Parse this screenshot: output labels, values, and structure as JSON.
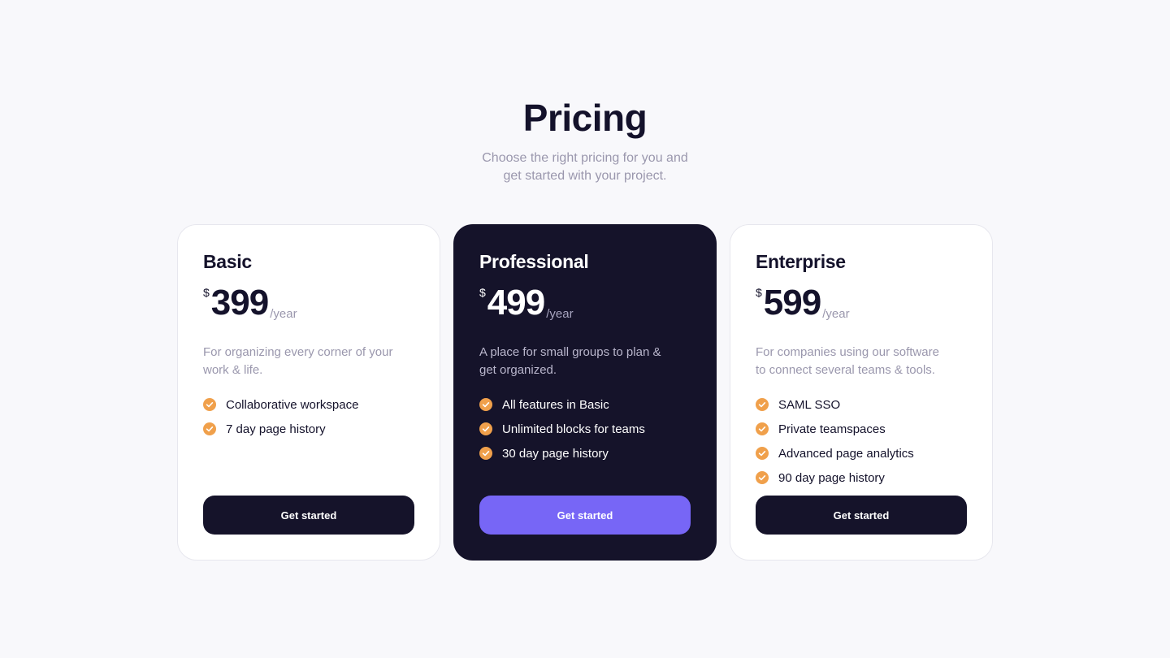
{
  "header": {
    "title": "Pricing",
    "subtitle": "Choose the right pricing for you and get started with your project."
  },
  "colors": {
    "background": "#f8f8fb",
    "dark": "#15132a",
    "accent": "#7766f6",
    "check": "#f0a04b",
    "muted_text": "#9a97ad"
  },
  "plans": [
    {
      "name": "Basic",
      "currency": "$",
      "price": "399",
      "period": "/year",
      "description": "For organizing every corner of your work & life.",
      "features": [
        "Collaborative workspace",
        "7 day page history"
      ],
      "cta": "Get started",
      "featured": false
    },
    {
      "name": "Professional",
      "currency": "$",
      "price": "499",
      "period": "/year",
      "description": "A place for small groups to plan & get organized.",
      "features": [
        "All features in Basic",
        "Unlimited blocks for teams",
        "30 day page history"
      ],
      "cta": "Get started",
      "featured": true
    },
    {
      "name": "Enterprise",
      "currency": "$",
      "price": "599",
      "period": "/year",
      "description": "For companies using our software to connect several teams & tools.",
      "features": [
        "SAML SSO",
        "Private teamspaces",
        "Advanced page analytics",
        "90 day page history"
      ],
      "cta": "Get started",
      "featured": false
    }
  ],
  "icons": {
    "feature_bullet": "check-circle-icon"
  }
}
